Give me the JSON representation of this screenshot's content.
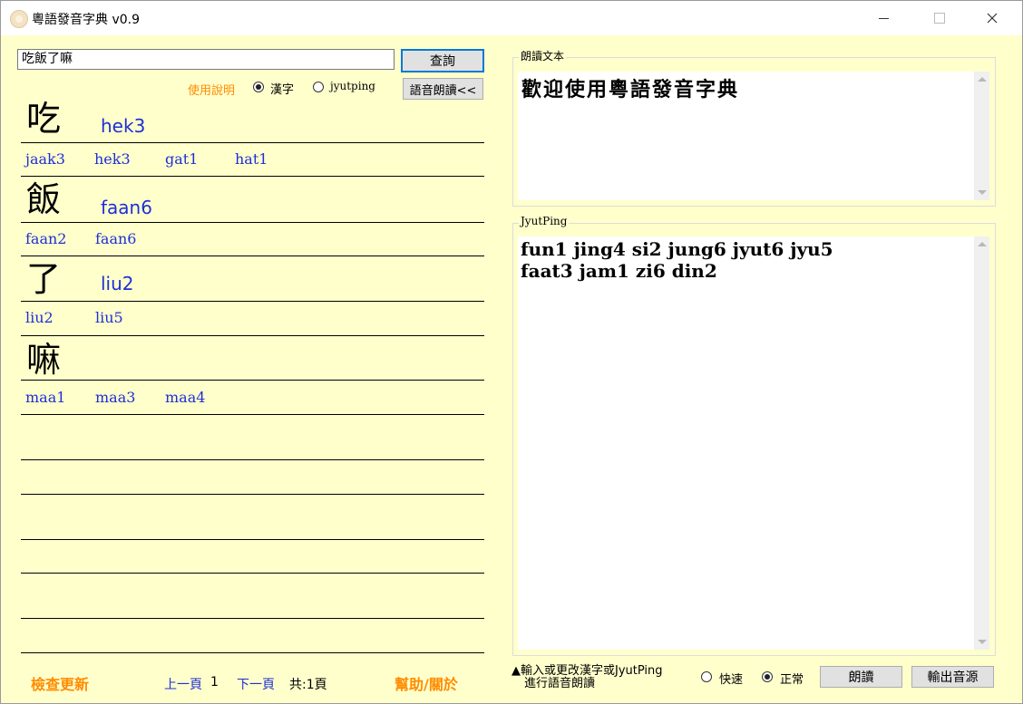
{
  "window": {
    "title": "粵語發音字典 v0.9"
  },
  "search": {
    "value": "吃飯了嘛",
    "query_button": "查詢",
    "speak_button": "語音朗讀<<",
    "help_link": "使用說明",
    "mode_options": [
      {
        "label": "漢字",
        "selected": true
      },
      {
        "label": "jyutping",
        "selected": false
      }
    ]
  },
  "entries": [
    {
      "char": "吃",
      "main": "hek3",
      "alts": [
        "jaak3",
        "hek3",
        "gat1",
        "hat1"
      ]
    },
    {
      "char": "飯",
      "main": "faan6",
      "alts": [
        "faan2",
        "faan6"
      ]
    },
    {
      "char": "了",
      "main": "liu2",
      "alts": [
        "liu2",
        "liu5"
      ]
    },
    {
      "char": "嘛",
      "main": "",
      "alts": [
        "maa1",
        "maa3",
        "maa4"
      ]
    }
  ],
  "footer": {
    "check_update": "檢查更新",
    "prev_page": "上一頁",
    "page_num": "1",
    "next_page": "下一頁",
    "total": "共:1頁",
    "help_about": "幫助/關於"
  },
  "reading": {
    "label": "朗讀文本",
    "text": "歡迎使用粵語發音字典"
  },
  "jyutping": {
    "label": "JyutPing",
    "text": "fun1 jing4 si2 jung6 jyut6 jyu5\nfaat3 jam1 zi6 din2"
  },
  "bottom": {
    "hint_line1": "▲輸入或更改漢字或JyutPing",
    "hint_line2": "進行語音朗讀",
    "speed_options": [
      {
        "label": "快速",
        "selected": false
      },
      {
        "label": "正常",
        "selected": true
      }
    ],
    "read_button": "朗讀",
    "export_button": "輸出音源"
  },
  "colors": {
    "background": "#ffffcc",
    "accent_blue": "#1e2fd6",
    "accent_orange": "#ff8c00"
  }
}
